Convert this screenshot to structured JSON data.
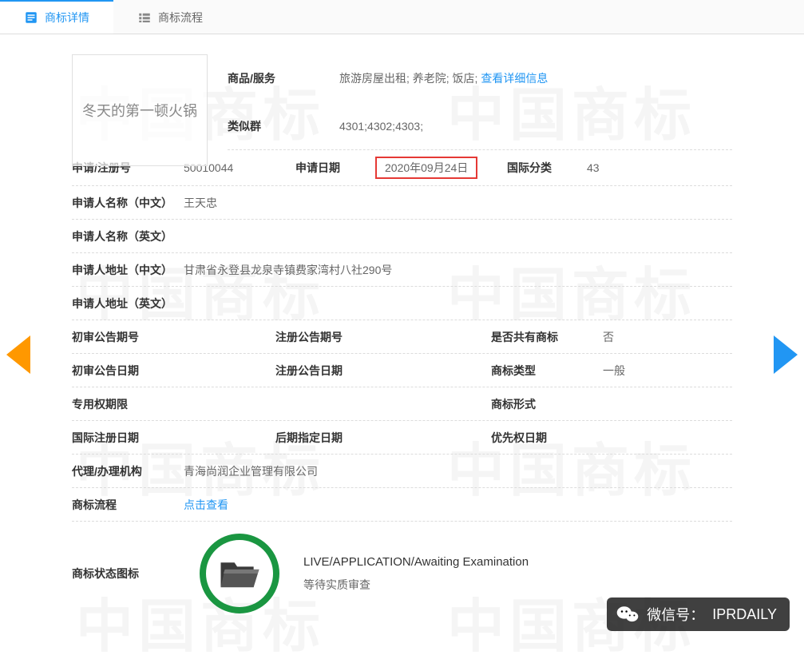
{
  "tabs": {
    "details": "商标详情",
    "process": "商标流程"
  },
  "trademark_name": "冬天的第一顿火锅",
  "header": {
    "goods_label": "商品/服务",
    "goods_value": "旅游房屋出租; 养老院; 饭店; ",
    "goods_link": "查看详细信息",
    "similar_label": "类似群",
    "similar_value": "4301;4302;4303;"
  },
  "reg": {
    "number_label": "申请/注册号",
    "number": "50010044",
    "date_label": "申请日期",
    "date": "2020年09月24日",
    "intl_class_label": "国际分类",
    "intl_class": "43"
  },
  "applicant": {
    "name_cn_label": "申请人名称（中文）",
    "name_cn": "王天忠",
    "name_en_label": "申请人名称（英文）",
    "name_en": "",
    "addr_cn_label": "申请人地址（中文）",
    "addr_cn": "甘肃省永登县龙泉寺镇费家湾村八社290号",
    "addr_en_label": "申请人地址（英文）",
    "addr_en": ""
  },
  "notice": {
    "prelim_no_label": "初审公告期号",
    "reg_no_label": "注册公告期号",
    "joint_label": "是否共有商标",
    "joint_value": "否",
    "prelim_date_label": "初审公告日期",
    "reg_date_label": "注册公告日期",
    "tm_type_label": "商标类型",
    "tm_type_value": "一般",
    "excl_label": "专用权期限",
    "tm_form_label": "商标形式",
    "intl_reg_date_label": "国际注册日期",
    "later_date_label": "后期指定日期",
    "priority_date_label": "优先权日期"
  },
  "agency": {
    "label": "代理/办理机构",
    "value": "青海尚润企业管理有限公司"
  },
  "process": {
    "label": "商标流程",
    "link": "点击查看"
  },
  "status": {
    "label": "商标状态图标",
    "en": "LIVE/APPLICATION/Awaiting Examination",
    "cn": "等待实质审查"
  },
  "watermark": "中国商标",
  "wechat": {
    "label": "微信号：",
    "id": "IPRDAILY"
  }
}
